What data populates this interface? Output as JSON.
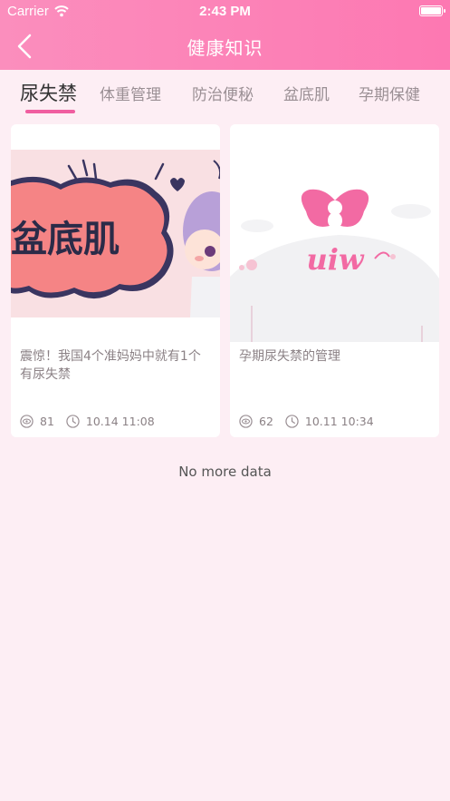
{
  "status": {
    "carrier": "Carrier",
    "time": "2:43 PM"
  },
  "nav": {
    "title": "健康知识",
    "back": "back"
  },
  "tabs": [
    {
      "label": "尿失禁",
      "active": true
    },
    {
      "label": "体重管理"
    },
    {
      "label": "防治便秘"
    },
    {
      "label": "盆底肌"
    },
    {
      "label": "孕期保健"
    }
  ],
  "cards": [
    {
      "image_text": "盆底肌",
      "title": "震惊！我国4个准妈妈中就有1个有尿失禁",
      "views": "81",
      "date": "10.14 11:08"
    },
    {
      "image_text": "uiw",
      "title": "孕期尿失禁的管理",
      "views": "62",
      "date": "10.11 10:34"
    }
  ],
  "footer": {
    "text": "No more data"
  },
  "colors": {
    "accent": "#f05ea0",
    "header_start": "#fb8ebd",
    "header_end": "#fd78b2",
    "background": "#fdeef4"
  }
}
